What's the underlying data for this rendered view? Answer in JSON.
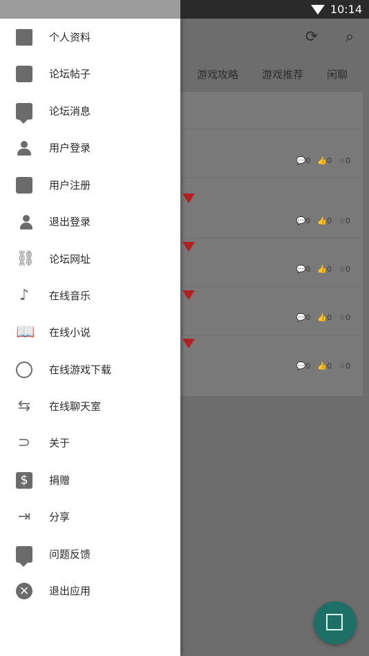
{
  "status_bar": {
    "time": "10:14",
    "icons": [
      "wifi-icon"
    ]
  },
  "background_app": {
    "toolbar_icons": [
      "refresh-icon",
      "search-icon"
    ],
    "tabs": [
      "游戏攻略",
      "游戏推荐",
      "闲聊"
    ],
    "rows": [
      {
        "comments": "0",
        "likes": "0",
        "stars": "0",
        "badge": false
      },
      {
        "comments": "0",
        "likes": "0",
        "stars": "0",
        "badge": true
      },
      {
        "comments": "0",
        "likes": "0",
        "stars": "0",
        "badge": true
      },
      {
        "comments": "0",
        "likes": "0",
        "stars": "0",
        "badge": true
      },
      {
        "comments": "0",
        "likes": "0",
        "stars": "0",
        "badge": true
      }
    ],
    "fab_icon": "edit-icon"
  },
  "drawer": {
    "items": [
      {
        "label": "个人资料",
        "icon": "document-icon"
      },
      {
        "label": "论坛帖子",
        "icon": "book-icon"
      },
      {
        "label": "论坛消息",
        "icon": "message-alert-icon"
      },
      {
        "label": "用户登录",
        "icon": "person-icon"
      },
      {
        "label": "用户注册",
        "icon": "account-box-icon"
      },
      {
        "label": "退出登录",
        "icon": "person-remove-icon"
      },
      {
        "label": "论坛网址",
        "icon": "link-icon"
      },
      {
        "label": "在线音乐",
        "icon": "music-note-icon"
      },
      {
        "label": "在线小说",
        "icon": "open-book-icon"
      },
      {
        "label": "在线游戏下载",
        "icon": "download-circle-icon"
      },
      {
        "label": "在线聊天室",
        "icon": "group-swap-icon"
      },
      {
        "label": "关于",
        "icon": "paperclip-icon"
      },
      {
        "label": "捐赠",
        "icon": "dollar-icon"
      },
      {
        "label": "分享",
        "icon": "exit-share-icon"
      },
      {
        "label": "问题反馈",
        "icon": "feedback-icon"
      },
      {
        "label": "退出应用",
        "icon": "close-circle-icon"
      }
    ]
  },
  "colors": {
    "drawer_bg": "#ffffff",
    "scrim": "#6d6d6d",
    "fab": "#1e6f66",
    "icon": "#6b6b6b"
  }
}
